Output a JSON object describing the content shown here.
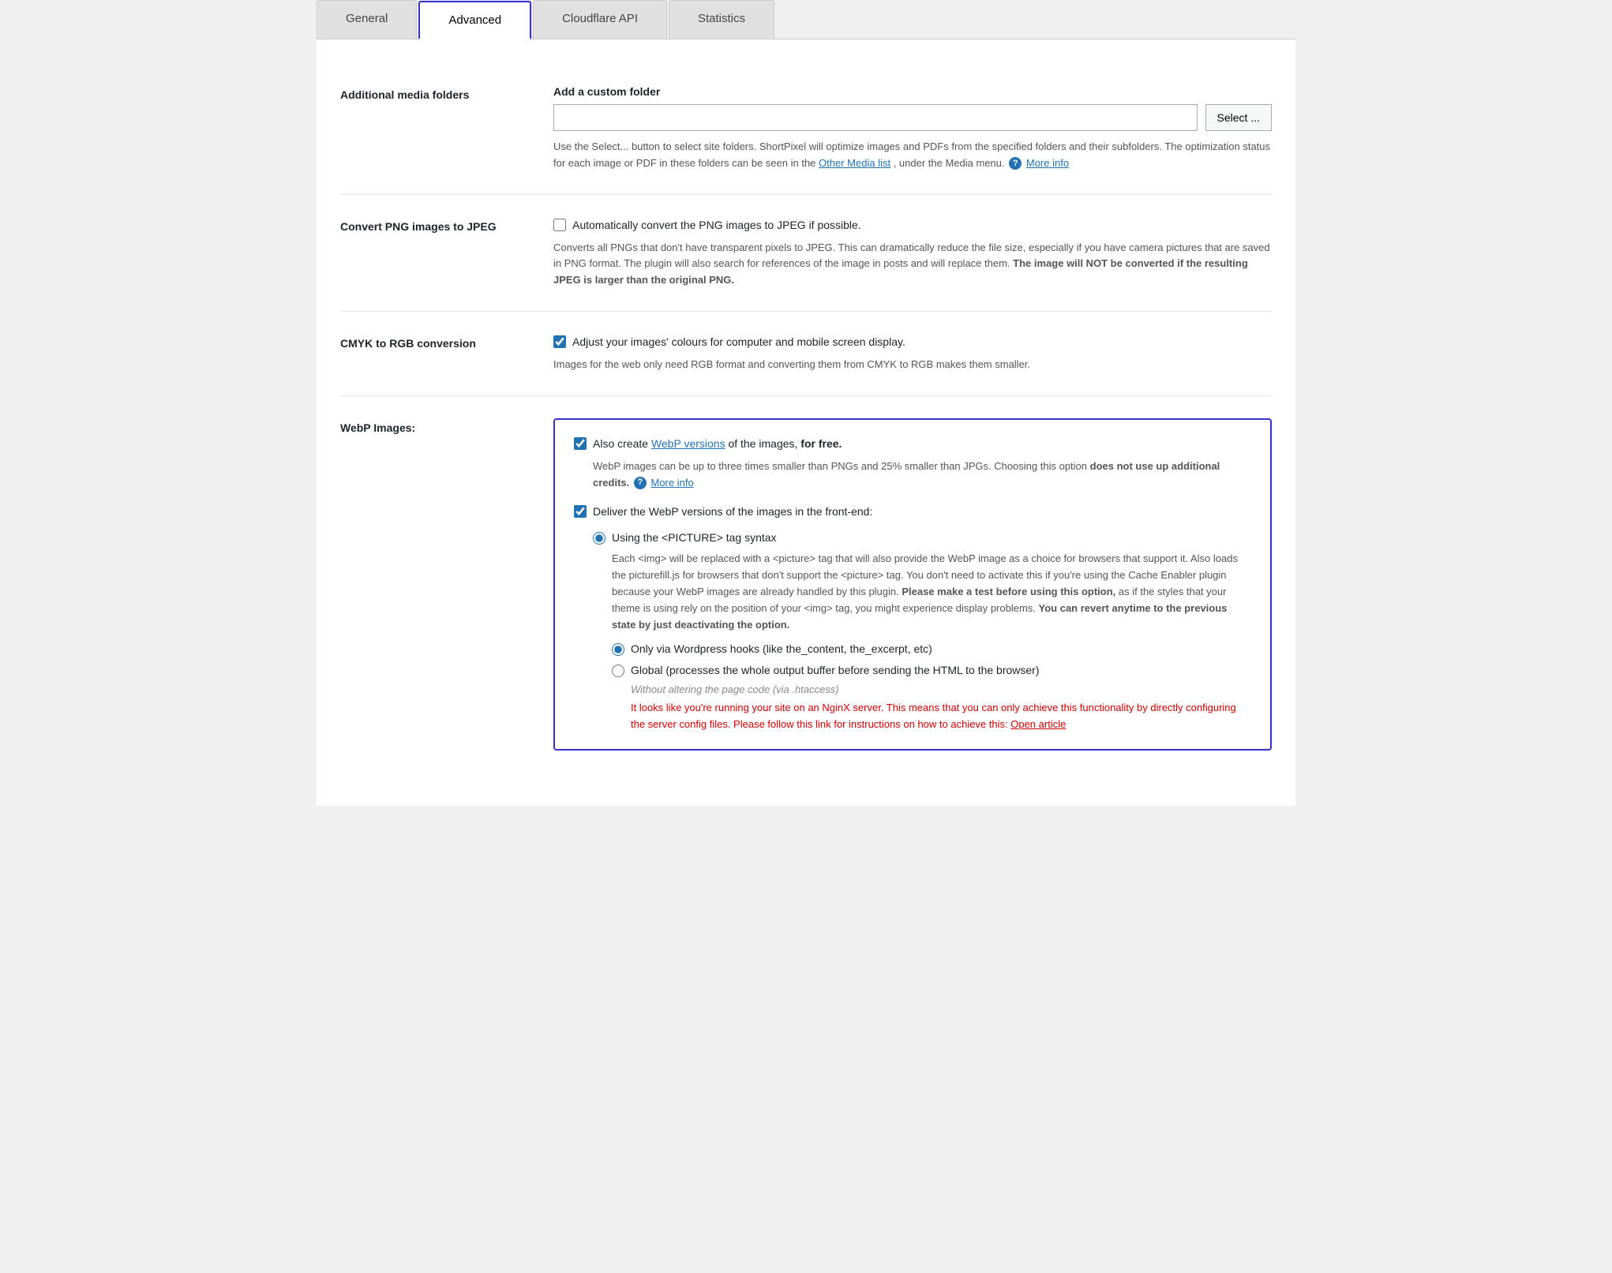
{
  "tabs": [
    {
      "id": "general",
      "label": "General",
      "active": false
    },
    {
      "id": "advanced",
      "label": "Advanced",
      "active": true
    },
    {
      "id": "cloudflare",
      "label": "Cloudflare API",
      "active": false
    },
    {
      "id": "statistics",
      "label": "Statistics",
      "active": false
    }
  ],
  "sections": {
    "additional_media": {
      "label": "Additional media folders",
      "sub_label": "Add a custom folder",
      "select_btn": "Select ...",
      "desc": "Use the Select... button to select site folders. ShortPixel will optimize images and PDFs from the specified folders and their subfolders. The optimization status for each image or PDF in these folders can be seen in the ",
      "other_media_link": "Other Media list",
      "desc2": ", under the Media menu.",
      "more_info_link": "More info"
    },
    "convert_png": {
      "label": "Convert PNG images to JPEG",
      "checkbox_label": "Automatically convert the PNG images to JPEG if possible.",
      "checkbox_checked": false,
      "desc": "Converts all PNGs that don't have transparent pixels to JPEG. This can dramatically reduce the file size, especially if you have camera pictures that are saved in PNG format. The plugin will also search for references of the image in posts and will replace them. ",
      "desc_bold": "The image will NOT be converted if the resulting JPEG is larger than the original PNG."
    },
    "cmyk": {
      "label": "CMYK to RGB conversion",
      "checkbox_label": "Adjust your images' colours for computer and mobile screen display.",
      "checkbox_checked": true,
      "desc": "Images for the web only need RGB format and converting them from CMYK to RGB makes them smaller."
    },
    "webp": {
      "label": "WebP Images:",
      "create_label": "Also create ",
      "webp_versions_link": "WebP versions",
      "create_label2": " of the images, ",
      "create_label3": "for free.",
      "create_checked": true,
      "webp_desc": "WebP images can be up to three times smaller than PNGs and 25% smaller than JPGs. Choosing this option ",
      "webp_desc_bold": "does not use up additional credits.",
      "more_info_link": "More info",
      "deliver_label": "Deliver the WebP versions of the images in the front-end:",
      "deliver_checked": true,
      "picture_radio_label": "Using the <PICTURE> tag syntax",
      "picture_radio_checked": true,
      "picture_desc_1": "Each <img> will be replaced with a <picture> tag that will also provide the WebP image as a choice for browsers that support it. Also loads the picturefill.js for browsers that don't support the <picture> tag. You don't need to activate this if you're using the Cache Enabler plugin because your WebP images are already handled by this plugin. ",
      "picture_desc_bold1": "Please make a test before using this option,",
      "picture_desc_2": " as if the styles that your theme is using rely on the position of your <img> tag, you might experience display problems. ",
      "picture_desc_bold2": "You can revert anytime to the previous state by just deactivating the option.",
      "sub_radios": [
        {
          "id": "wp_hooks",
          "label": "Only via Wordpress hooks (like the_content, the_excerpt, etc)",
          "checked": true
        },
        {
          "id": "global",
          "label": "Global (processes the whole output buffer before sending the HTML to the browser)",
          "checked": false
        }
      ],
      "without_altering": "Without altering the page code (via .htaccess)",
      "nginx_warning": "It looks like you're running your site on an NginX server. This means that you can only achieve this functionality by directly configuring the server config files. Please follow this link for instructions on how to achieve this: ",
      "open_article_link": "Open article"
    }
  }
}
